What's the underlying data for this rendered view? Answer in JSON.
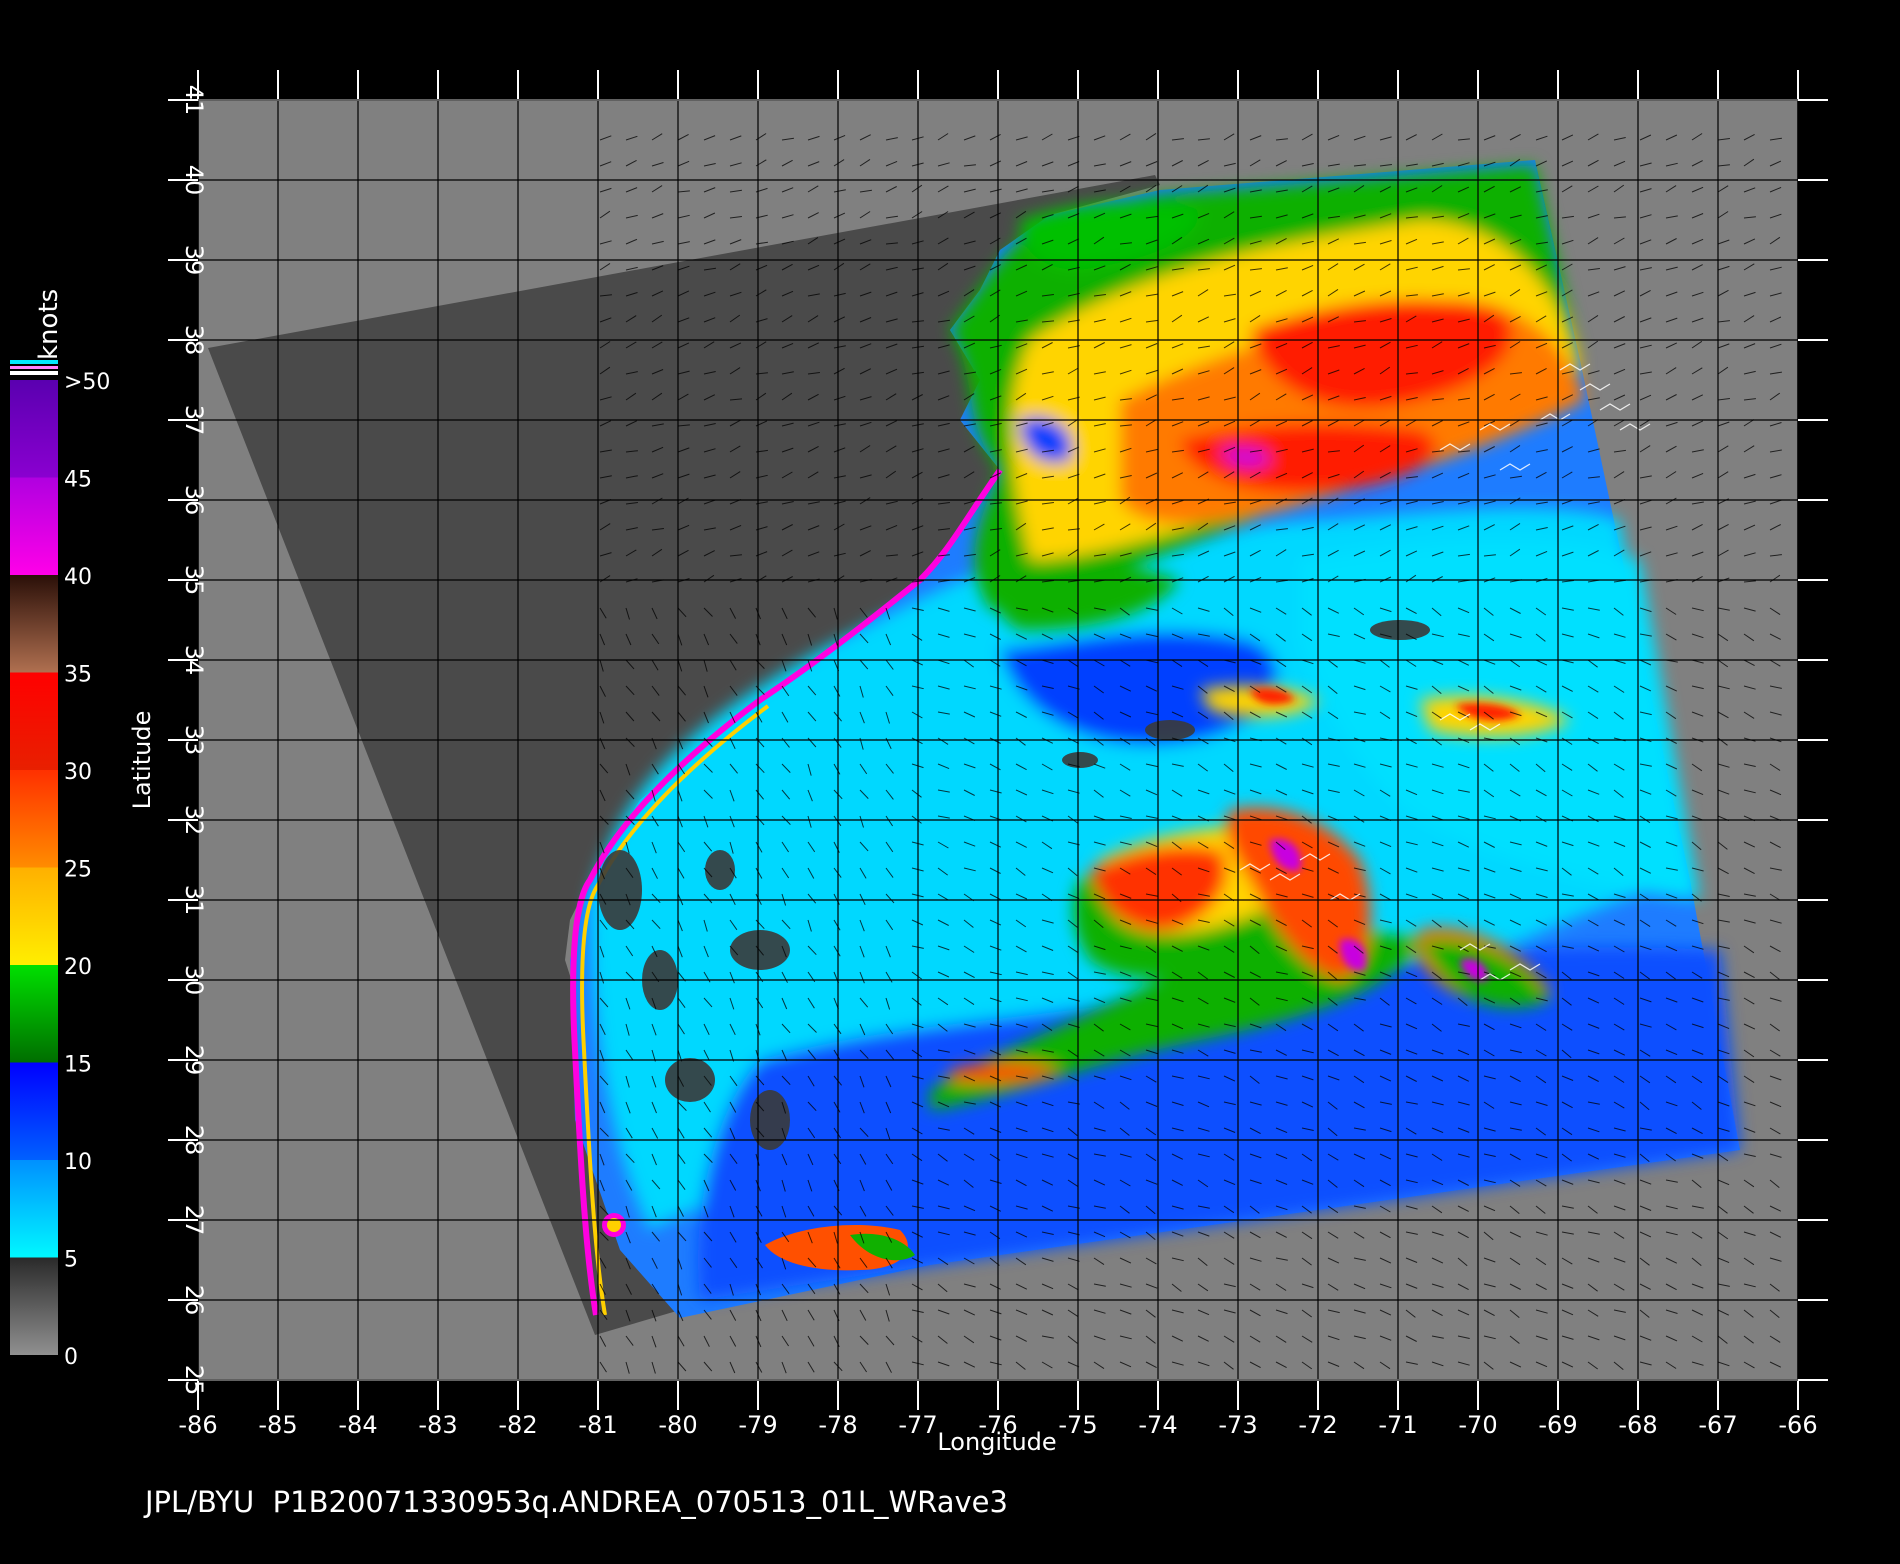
{
  "colorbar": {
    "unit_label": "knots",
    "labels": [
      ">50",
      "45",
      "40",
      "35",
      "30",
      "25",
      "20",
      "15",
      "10",
      "5",
      "0"
    ],
    "bands": [
      {
        "range": [
          45,
          50
        ],
        "colors": [
          "#5a00b0",
          "#8a00d0"
        ]
      },
      {
        "range": [
          40,
          45
        ],
        "colors": [
          "#b000e0",
          "#ff00e8"
        ]
      },
      {
        "range": [
          35,
          40
        ],
        "colors": [
          "#2a0f08",
          "#b07050"
        ]
      },
      {
        "range": [
          30,
          35
        ],
        "colors": [
          "#ff0000",
          "#e82000"
        ]
      },
      {
        "range": [
          25,
          30
        ],
        "colors": [
          "#ff3000",
          "#ff8c00"
        ]
      },
      {
        "range": [
          20,
          25
        ],
        "colors": [
          "#ffb000",
          "#ffee00"
        ]
      },
      {
        "range": [
          15,
          20
        ],
        "colors": [
          "#00e000",
          "#006e00"
        ]
      },
      {
        "range": [
          10,
          15
        ],
        "colors": [
          "#0000ff",
          "#0060ff"
        ]
      },
      {
        "range": [
          5,
          10
        ],
        "colors": [
          "#0090ff",
          "#00f8ff"
        ]
      },
      {
        "range": [
          0,
          5
        ],
        "colors": [
          "#2a2a2a",
          "#909090"
        ]
      }
    ]
  },
  "map": {
    "x_axis": {
      "label": "Longitude",
      "range": [
        -86,
        -66
      ],
      "ticks": [
        "-86",
        "-85",
        "-84",
        "-83",
        "-82",
        "-81",
        "-80",
        "-79",
        "-78",
        "-77",
        "-76",
        "-75",
        "-74",
        "-73",
        "-72",
        "-71",
        "-70",
        "-69",
        "-68",
        "-67",
        "-66"
      ]
    },
    "y_axis": {
      "label": "Latitude",
      "range": [
        25,
        41
      ],
      "ticks": [
        "25",
        "26",
        "27",
        "28",
        "29",
        "30",
        "31",
        "32",
        "33",
        "34",
        "35",
        "36",
        "37",
        "38",
        "39",
        "40",
        "41"
      ]
    },
    "grid": true,
    "background_color": "#808080",
    "land_color": "#484848",
    "swath_corners_lonlat": [
      [
        -81,
        25.6
      ],
      [
        -79.9,
        25.8
      ],
      [
        -66.7,
        27.9
      ],
      [
        -69.3,
        40.2
      ],
      [
        -74,
        40.1
      ],
      [
        -85.8,
        37.9
      ]
    ],
    "scene": "ocean surface wind speed, Subtropical Storm Andrea, US southeast coast"
  },
  "footer": {
    "caption": "JPL/BYU  P1B20071330953q.ANDREA_070513_01L_WRave3"
  }
}
